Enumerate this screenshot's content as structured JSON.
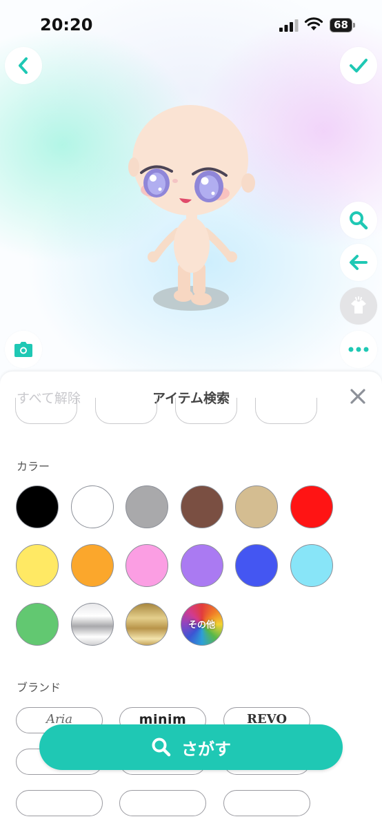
{
  "status_bar": {
    "time": "20:20",
    "battery": "68"
  },
  "sheet": {
    "clear_all": "すべて解除",
    "title": "アイテム検索"
  },
  "color_section": {
    "label": "カラー",
    "swatches": [
      {
        "name": "black",
        "color": "#000000"
      },
      {
        "name": "white",
        "color": "#ffffff"
      },
      {
        "name": "gray",
        "color": "#a9a9ab"
      },
      {
        "name": "brown",
        "color": "#7a4f42"
      },
      {
        "name": "beige",
        "color": "#d4bd91"
      },
      {
        "name": "red",
        "color": "#ff1414"
      },
      {
        "name": "yellow",
        "color": "#ffe964"
      },
      {
        "name": "orange",
        "color": "#fba72c"
      },
      {
        "name": "pink",
        "color": "#fb9ee3"
      },
      {
        "name": "purple",
        "color": "#aa7af2"
      },
      {
        "name": "blue",
        "color": "#4456f2"
      },
      {
        "name": "light-blue",
        "color": "#88e5f8"
      },
      {
        "name": "green",
        "color": "#62c871"
      },
      {
        "name": "silver",
        "color": "#c7c7c9"
      },
      {
        "name": "gold",
        "color": "#c9a85a"
      },
      {
        "name": "other",
        "color": "rainbow",
        "label": "その他"
      }
    ]
  },
  "brand_section": {
    "label": "ブランド",
    "brands": [
      "Aria",
      "minim",
      "REVO"
    ]
  },
  "search_button": {
    "label": "さがす"
  },
  "accent_color": "#1fc8b4"
}
